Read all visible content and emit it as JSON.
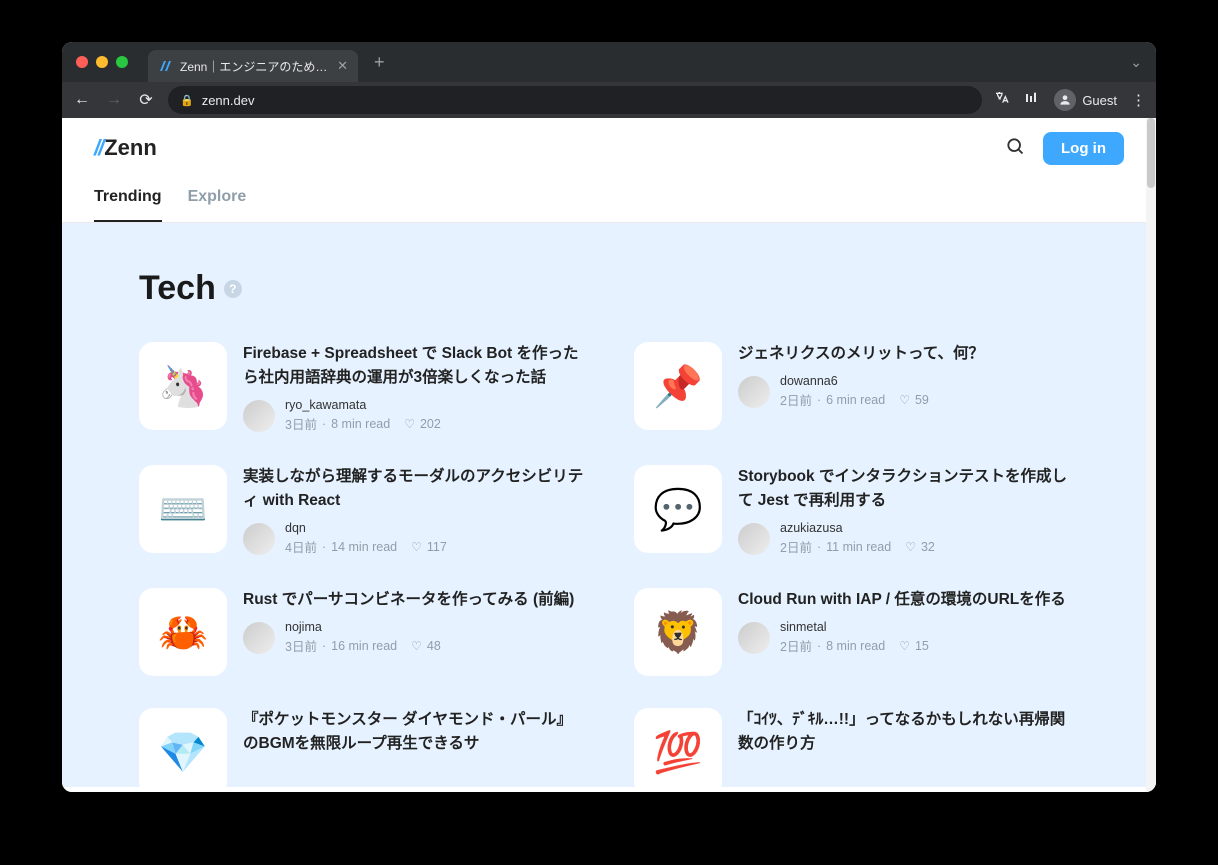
{
  "browser": {
    "tab_title": "Zenn｜エンジニアのための情報共",
    "url": "zenn.dev",
    "guest_label": "Guest"
  },
  "header": {
    "logo_text": "Zenn",
    "login_label": "Log in"
  },
  "tabs": [
    {
      "label": "Trending",
      "active": true
    },
    {
      "label": "Explore",
      "active": false
    }
  ],
  "section": {
    "title": "Tech"
  },
  "articles": [
    {
      "emoji": "🦄",
      "title": "Firebase + Spreadsheet で Slack Bot を作ったら社内用語辞典の運用が3倍楽しくなった話",
      "author": "ryo_kawamata",
      "age": "3日前",
      "read": "8 min read",
      "likes": "202"
    },
    {
      "emoji": "📌",
      "title": "ジェネリクスのメリットって、何？",
      "author": "dowanna6",
      "age": "2日前",
      "read": "6 min read",
      "likes": "59"
    },
    {
      "emoji": "⌨️",
      "title": "実装しながら理解するモーダルのアクセシビリティ with React",
      "author": "dqn",
      "age": "4日前",
      "read": "14 min read",
      "likes": "117"
    },
    {
      "emoji": "💬",
      "title": "Storybook でインタラクションテストを作成して Jest で再利用する",
      "author": "azukiazusa",
      "age": "2日前",
      "read": "11 min read",
      "likes": "32"
    },
    {
      "emoji": "🦀",
      "title": "Rust でパーサコンビネータを作ってみる (前編)",
      "author": "nojima",
      "age": "3日前",
      "read": "16 min read",
      "likes": "48"
    },
    {
      "emoji": "🦁",
      "title": "Cloud Run with IAP / 任意の環境のURLを作る",
      "author": "sinmetal",
      "age": "2日前",
      "read": "8 min read",
      "likes": "15"
    },
    {
      "emoji": "💎",
      "title": "『ポケットモンスター ダイヤモンド・パール』のBGMを無限ループ再生できるサ",
      "author": "",
      "age": "",
      "read": "",
      "likes": ""
    },
    {
      "emoji": "💯",
      "title": "「ｺｲﾂ、ﾃﾞｷﾙ…!!」ってなるかもしれない再帰関数の作り方",
      "author": "",
      "age": "",
      "read": "",
      "likes": ""
    }
  ]
}
